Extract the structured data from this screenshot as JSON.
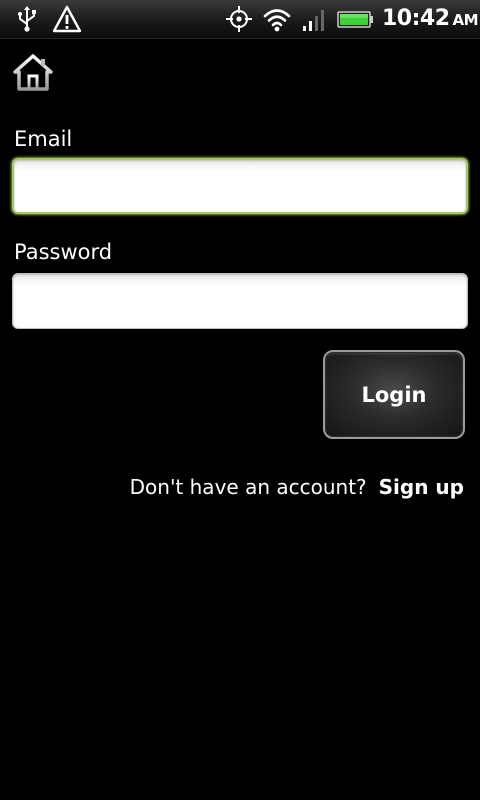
{
  "status_bar": {
    "time": "10:42",
    "ampm": "AM",
    "icons": [
      "usb-icon",
      "warning-icon",
      "gps-icon",
      "wifi-icon",
      "signal-icon",
      "battery-icon"
    ],
    "battery_color": "#3fd03a"
  },
  "toolbar": {
    "home_icon": "home-icon"
  },
  "form": {
    "email_label": "Email",
    "email_value": "",
    "password_label": "Password",
    "password_value": "",
    "login_label": "Login",
    "focus_color": "#a8c66c"
  },
  "signup": {
    "prompt": "Don't have an account?",
    "link_label": "Sign up"
  }
}
